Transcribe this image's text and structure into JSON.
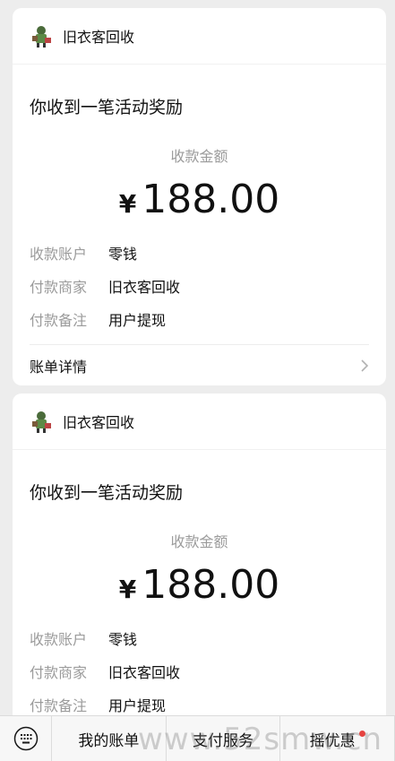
{
  "cards": [
    {
      "merchant": "旧衣客回收",
      "headline": "你收到一笔活动奖励",
      "amount_label": "收款金额",
      "currency": "¥",
      "amount": "188.00",
      "rows": [
        {
          "label": "收款账户",
          "value": "零钱"
        },
        {
          "label": "付款商家",
          "value": "旧衣客回收"
        },
        {
          "label": "付款备注",
          "value": "用户提现"
        }
      ],
      "detail_link": "账单详情"
    },
    {
      "merchant": "旧衣客回收",
      "headline": "你收到一笔活动奖励",
      "amount_label": "收款金额",
      "currency": "¥",
      "amount": "188.00",
      "rows": [
        {
          "label": "收款账户",
          "value": "零钱"
        },
        {
          "label": "付款商家",
          "value": "旧衣客回收"
        },
        {
          "label": "付款备注",
          "value": "用户提现"
        }
      ]
    }
  ],
  "bottom_menu": {
    "items": [
      "我的账单",
      "支付服务",
      "摇优惠"
    ],
    "badge_color": "#e64340"
  },
  "watermark": "www.52smw.cn"
}
